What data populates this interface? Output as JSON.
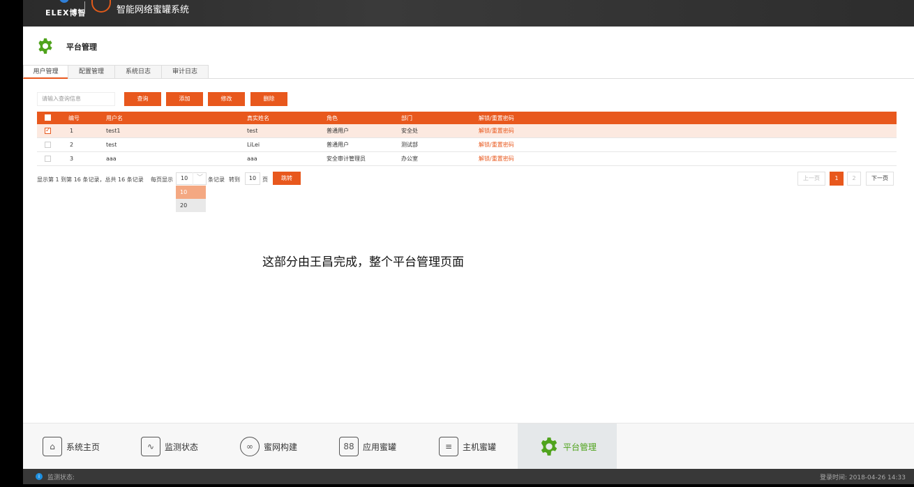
{
  "header": {
    "logo_text": "ELEX博智",
    "system_title": "智能网络蜜罐系统"
  },
  "page": {
    "title": "平台管理"
  },
  "tabs": [
    "用户管理",
    "配置管理",
    "系统日志",
    "审计日志"
  ],
  "toolbar": {
    "search_placeholder": "请输入查询信息",
    "query": "查询",
    "add": "添加",
    "edit": "修改",
    "delete": "删除"
  },
  "table": {
    "headers": [
      "编号",
      "用户名",
      "真实姓名",
      "角色",
      "部门",
      "解锁/重置密码"
    ],
    "rows": [
      {
        "id": "1",
        "username": "test1",
        "realname": "test",
        "role": "普通用户",
        "dept": "安全处",
        "action": "解锁/重置密码",
        "checked": true
      },
      {
        "id": "2",
        "username": "test",
        "realname": "LiLei",
        "role": "普通用户",
        "dept": "测试部",
        "action": "解锁/重置密码",
        "checked": false
      },
      {
        "id": "3",
        "username": "aaa",
        "realname": "aaa",
        "role": "安全审计管理员",
        "dept": "办公室",
        "action": "解锁/重置密码",
        "checked": false
      }
    ]
  },
  "pagination": {
    "info": "显示第 1 到第 16 条记录，总共 16 条记录",
    "per_page_label": "每页显示",
    "per_page_value": "10",
    "per_page_options": [
      "10",
      "20"
    ],
    "records_label": "条记录",
    "goto_label": "转到",
    "goto_value": "10",
    "page_unit": "页",
    "jump": "跳转",
    "prev": "上一页",
    "pages": [
      "1",
      "2"
    ],
    "current_page": "1",
    "next": "下一页"
  },
  "note": "这部分由王昌完成，整个平台管理页面",
  "bottom_nav": [
    {
      "label": "系统主页",
      "icon": "home-icon",
      "glyph": "⌂"
    },
    {
      "label": "监测状态",
      "icon": "monitor-icon",
      "glyph": "∿"
    },
    {
      "label": "蜜网构建",
      "icon": "network-icon",
      "glyph": "∞"
    },
    {
      "label": "应用蜜罐",
      "icon": "app-icon",
      "glyph": "88"
    },
    {
      "label": "主机蜜罐",
      "icon": "host-icon",
      "glyph": "≡"
    },
    {
      "label": "平台管理",
      "icon": "gear-icon",
      "glyph": "",
      "active": true
    }
  ],
  "status": {
    "left": "监测状态:",
    "right": "登录时间: 2018-04-26 14:33"
  },
  "colors": {
    "accent": "#e8581d",
    "active_nav": "#4fa31c",
    "info_dot": "#1d8fe0"
  }
}
